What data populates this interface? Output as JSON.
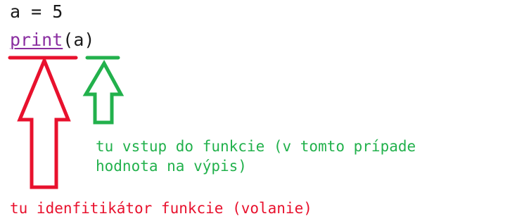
{
  "code": {
    "line1": "a = 5",
    "line2_func": "print",
    "line2_args": "(a)"
  },
  "annotations": {
    "green_note_line1": "tu vstup do funkcie (v tomto prípade",
    "green_note_line2": "hodnota na výpis)",
    "red_note": "tu idenfitikátor funkcie (volanie)"
  },
  "colors": {
    "red": "#e8112d",
    "green": "#22b14c",
    "keyword": "#8a2ea0",
    "code_text": "#1a1a1a"
  }
}
